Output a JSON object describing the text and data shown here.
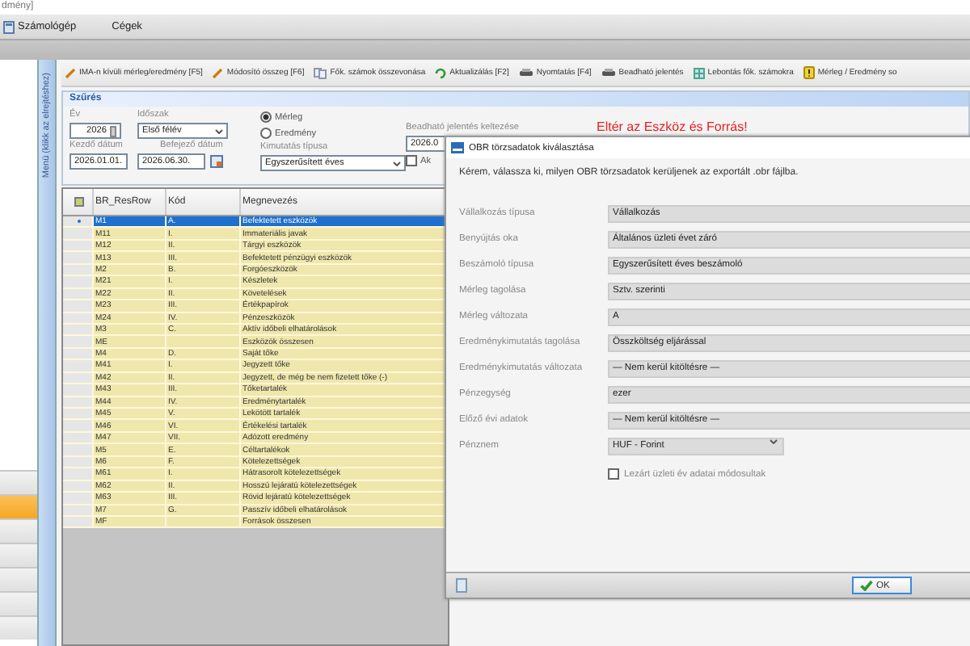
{
  "window": {
    "title": "dmény]"
  },
  "menu": [
    "Számológép",
    "Cégek"
  ],
  "left_nav": {
    "items": [
      {
        "selected": false
      },
      {
        "selected": true
      },
      {
        "selected": false
      },
      {
        "selected": false
      },
      {
        "selected": false
      },
      {
        "selected": false
      },
      {
        "selected": false
      }
    ]
  },
  "sidebar_strip": {
    "label": "Menü (klikk az elrejtéshez)"
  },
  "toolbar": [
    "IMA-n kívüli mérleg/eredmény [F5]",
    "Módosító összeg [F6]",
    "Fők. számok összevonása",
    "Aktualizálás [F2]",
    "Nyomtatás [F4]",
    "Beadható jelentés",
    "Lebontás fők. számokra",
    "Mérleg / Eredmény so"
  ],
  "filter": {
    "title": "Szűrés",
    "year_label": "Év",
    "year": "2026",
    "period_label": "Időszak",
    "period": "Első félév",
    "start_label": "Kezdő dátum",
    "start": "2026.01.01.",
    "end_label": "Befejező dátum",
    "end": "2026.06.30.",
    "radios": [
      {
        "label": "Mérleg",
        "selected": true
      },
      {
        "label": "Eredmény",
        "selected": false
      }
    ],
    "report_type_label": "Kimutatás típusa",
    "report_type": "Egyszerűsített éves",
    "submit_date_label": "Beadható jelentés keltezése",
    "submit_date": "2026.0",
    "checkbox": {
      "label": "Ak",
      "checked": false
    },
    "warning": "Eltér az Eszköz és Forrás!"
  },
  "table": {
    "columns": [
      "BR_ResRow",
      "Kód",
      "Megnevezés"
    ],
    "rows": [
      {
        "cells": [
          "M1",
          "A.",
          "Befektetett eszközök"
        ],
        "selected": true
      },
      {
        "cells": [
          "M11",
          "I.",
          "Immateriális javak"
        ],
        "selected": false
      },
      {
        "cells": [
          "M12",
          "II.",
          "Tárgyi eszközök"
        ],
        "selected": false
      },
      {
        "cells": [
          "M13",
          "III.",
          "Befektetett pénzügyi eszközök"
        ],
        "selected": false
      },
      {
        "cells": [
          "M2",
          "B.",
          "Forgóeszközök"
        ],
        "selected": false
      },
      {
        "cells": [
          "M21",
          "I.",
          "Készletek"
        ],
        "selected": false
      },
      {
        "cells": [
          "M22",
          "II.",
          "Követelések"
        ],
        "selected": false
      },
      {
        "cells": [
          "M23",
          "III.",
          "Értékpapírok"
        ],
        "selected": false
      },
      {
        "cells": [
          "M24",
          "IV.",
          "Pénzeszközök"
        ],
        "selected": false
      },
      {
        "cells": [
          "M3",
          "C.",
          "Aktív időbeli elhatárolások"
        ],
        "selected": false
      },
      {
        "cells": [
          "ME",
          "",
          "Eszközök összesen"
        ],
        "selected": false
      },
      {
        "cells": [
          "M4",
          "D.",
          "Saját tőke"
        ],
        "selected": false
      },
      {
        "cells": [
          "M41",
          "I.",
          "Jegyzett tőke"
        ],
        "selected": false
      },
      {
        "cells": [
          "M42",
          "II.",
          "Jegyzett, de még be nem fizetett tőke (-)"
        ],
        "selected": false
      },
      {
        "cells": [
          "M43",
          "III.",
          "Tőketartalék"
        ],
        "selected": false
      },
      {
        "cells": [
          "M44",
          "IV.",
          "Eredménytartalék"
        ],
        "selected": false
      },
      {
        "cells": [
          "M45",
          "V.",
          "Lekötött tartalék"
        ],
        "selected": false
      },
      {
        "cells": [
          "M46",
          "VI.",
          "Értékelési tartalék"
        ],
        "selected": false
      },
      {
        "cells": [
          "M47",
          "VII.",
          "Adózott eredmény"
        ],
        "selected": false
      },
      {
        "cells": [
          "M5",
          "E.",
          "Céltartalékok"
        ],
        "selected": false
      },
      {
        "cells": [
          "M6",
          "F.",
          "Kötelezettségek"
        ],
        "selected": false
      },
      {
        "cells": [
          "M61",
          "I.",
          "Hátrasorolt kötelezettségek"
        ],
        "selected": false
      },
      {
        "cells": [
          "M62",
          "II.",
          "Hosszú lejáratú kötelezettségek"
        ],
        "selected": false
      },
      {
        "cells": [
          "M63",
          "III.",
          "Rövid lejáratú kötelezettségek"
        ],
        "selected": false
      },
      {
        "cells": [
          "M7",
          "G.",
          "Passzív időbeli elhatárolások"
        ],
        "selected": false
      },
      {
        "cells": [
          "MF",
          "",
          "Források összesen"
        ],
        "selected": false
      }
    ]
  },
  "dialog": {
    "title": "OBR törzsadatok kiválasztása",
    "message": "Kérem, válassza ki, milyen OBR törzsadatok kerüljenek az exportált .obr fájlba.",
    "fields": [
      {
        "label": "Vállalkozás típusa",
        "value": "Vállalkozás",
        "kind": "text"
      },
      {
        "label": "Benyújtás oka",
        "value": "Általános üzleti évet záró",
        "kind": "text"
      },
      {
        "label": "Beszámoló típusa",
        "value": "Egyszerűsített éves beszámoló",
        "kind": "text"
      },
      {
        "label": "Mérleg tagolása",
        "value": "Sztv. szerinti",
        "kind": "text"
      },
      {
        "label": "Mérleg változata",
        "value": "A",
        "kind": "text"
      },
      {
        "label": "Eredménykimutatás tagolása",
        "value": "Összköltség eljárással",
        "kind": "text"
      },
      {
        "label": "Eredménykimutatás változata",
        "value": "— Nem kerül kitöltésre —",
        "kind": "text"
      },
      {
        "label": "Pénzegység",
        "value": "ezer",
        "kind": "text"
      },
      {
        "label": "Előző évi adatok",
        "value": "— Nem kerül kitöltésre —",
        "kind": "text"
      },
      {
        "label": "Pénznem",
        "value": "HUF - Forint",
        "kind": "select"
      }
    ],
    "checkbox": {
      "label": "Lezárt üzleti év adatai módosultak",
      "checked": false
    },
    "ok": "OK"
  }
}
